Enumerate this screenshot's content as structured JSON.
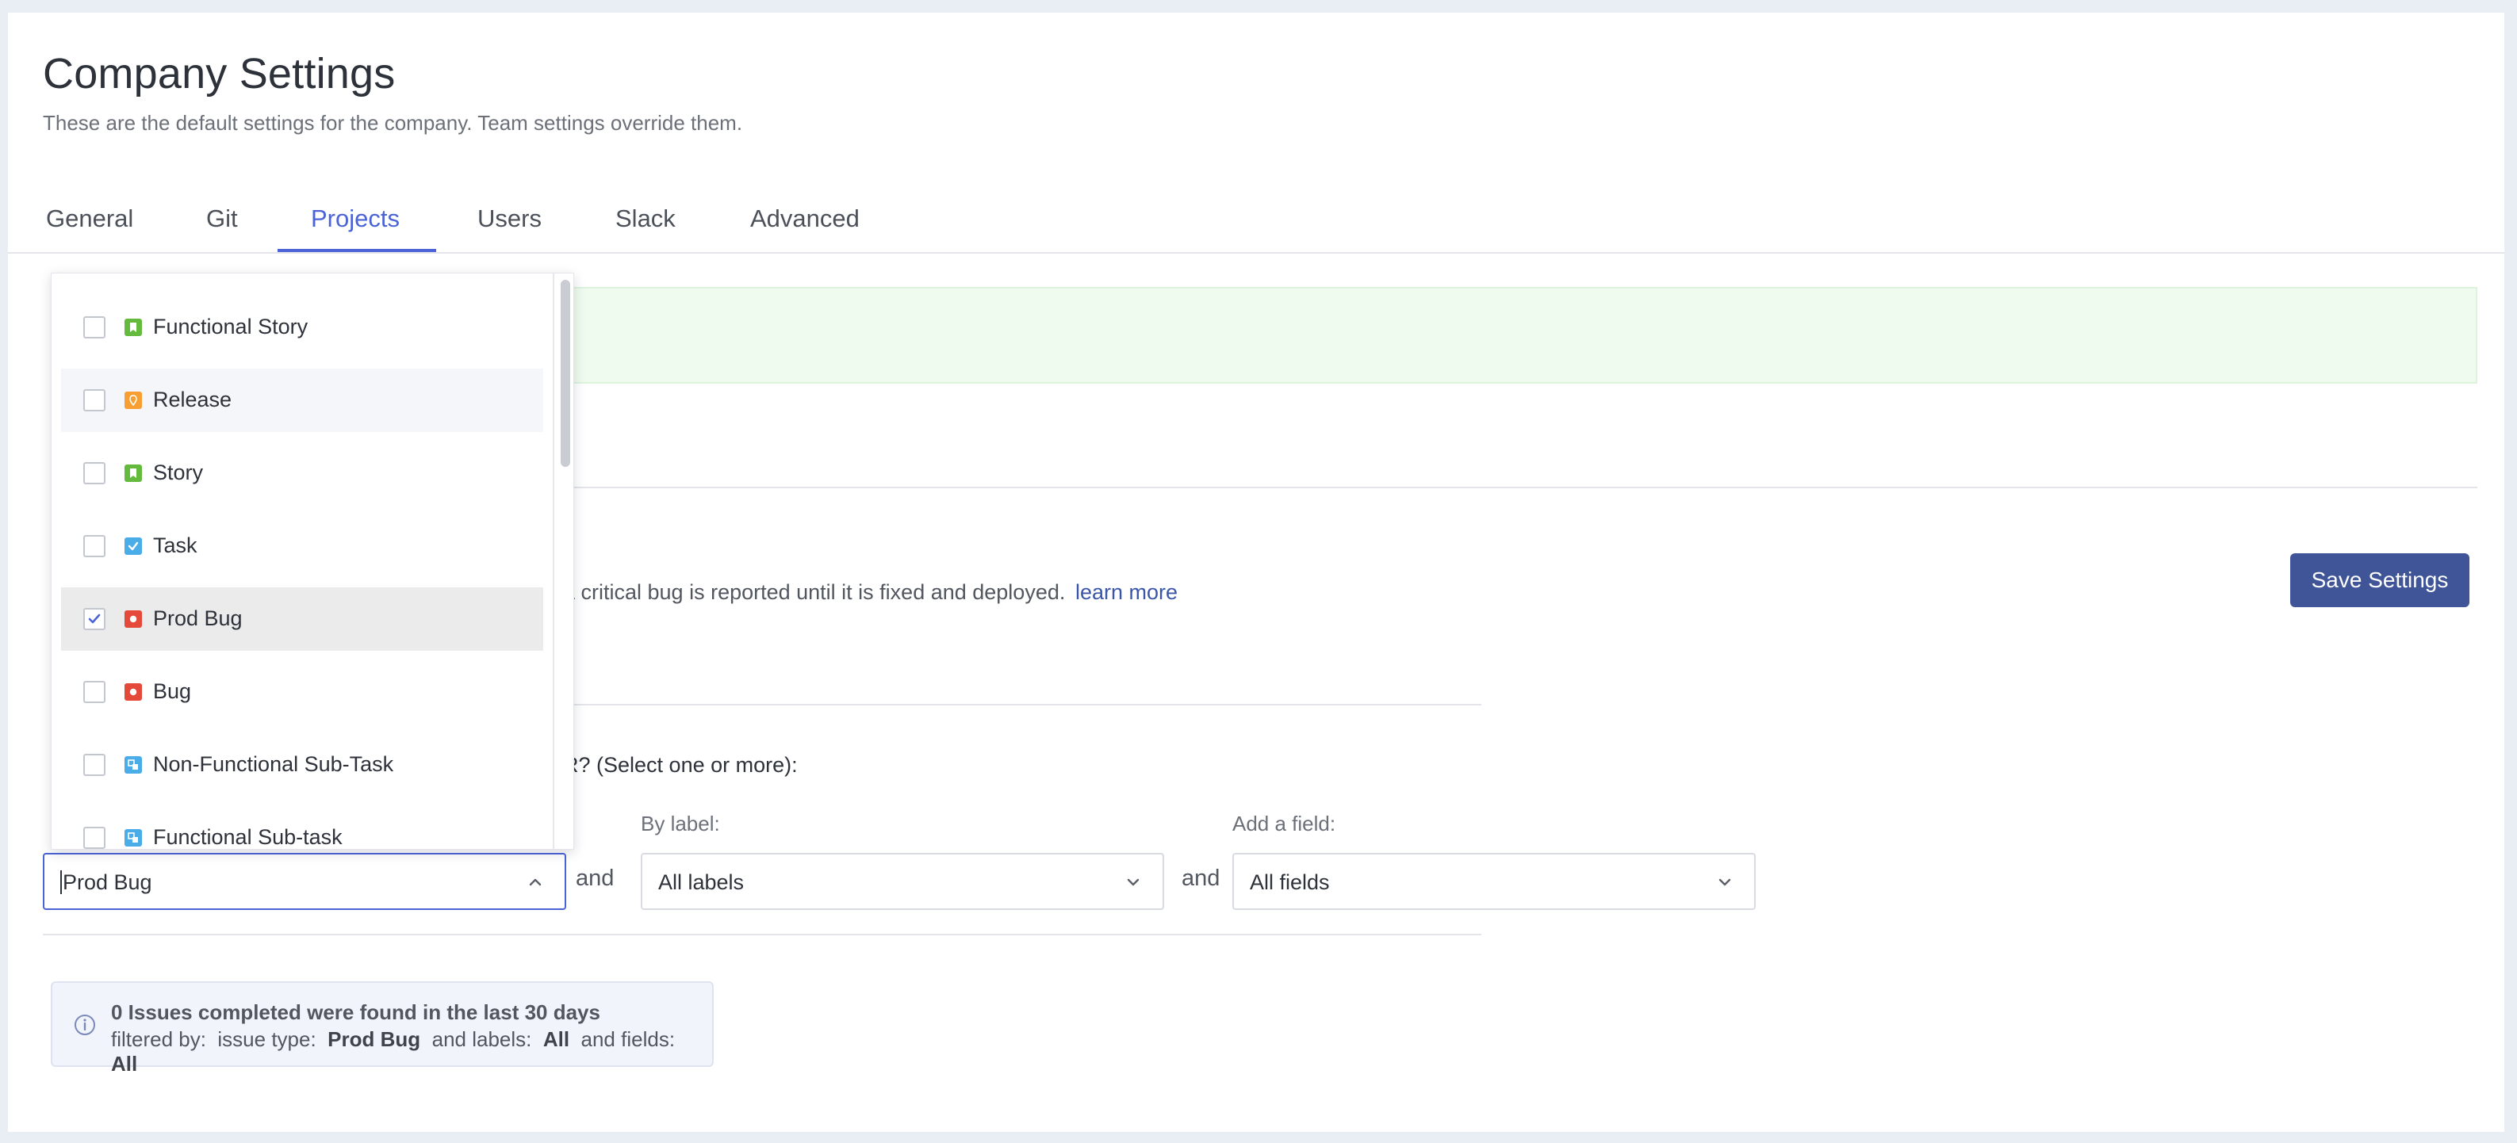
{
  "page": {
    "title": "Company Settings",
    "subtitle": "These are the default settings for the company. Team settings override them."
  },
  "tabs": [
    {
      "label": "General"
    },
    {
      "label": "Git"
    },
    {
      "label": "Projects",
      "active": true
    },
    {
      "label": "Users"
    },
    {
      "label": "Slack"
    },
    {
      "label": "Advanced"
    }
  ],
  "section": {
    "description_partial": "a critical bug is reported until it is fixed and deployed.",
    "learn_more": "learn more",
    "question_partial": "R? (Select one or more):",
    "save_label": "Save Settings"
  },
  "filters": {
    "issue_type_value": "Prod Bug",
    "and_1": "and",
    "label_label": "By label:",
    "label_value": "All labels",
    "and_2": "and",
    "field_label": "Add a field:",
    "field_value": "All fields"
  },
  "dropdown": {
    "items": [
      {
        "label": "Functional Story",
        "icon": "story-icon",
        "icon_color": "#63ba3c",
        "checked": false
      },
      {
        "label": "Release",
        "icon": "release-icon",
        "icon_color": "#f79f33",
        "checked": false
      },
      {
        "label": "Story",
        "icon": "story-icon",
        "icon_color": "#63ba3c",
        "checked": false
      },
      {
        "label": "Task",
        "icon": "task-icon",
        "icon_color": "#4bade8",
        "checked": false
      },
      {
        "label": "Prod Bug",
        "icon": "bug-icon",
        "icon_color": "#e5493a",
        "checked": true
      },
      {
        "label": "Bug",
        "icon": "bug-icon",
        "icon_color": "#e5493a",
        "checked": false
      },
      {
        "label": "Non-Functional Sub-Task",
        "icon": "subtask-icon",
        "icon_color": "#4bade8",
        "checked": false
      },
      {
        "label": "Functional Sub-task",
        "icon": "subtask-icon",
        "icon_color": "#4bade8",
        "checked": false
      }
    ]
  },
  "info": {
    "summary": "0 Issues completed were found in the last 30 days",
    "filtered_by": "filtered by:",
    "issue_type_label": "issue type:",
    "issue_type_value": "Prod Bug",
    "labels_label": "and labels:",
    "labels_value": "All",
    "fields_label": "and fields:",
    "fields_value": "All"
  },
  "colors": {
    "accent": "#4b63d6",
    "primary_button": "#3f5598",
    "link": "#3a56a8",
    "banner_bg": "#effbef"
  }
}
